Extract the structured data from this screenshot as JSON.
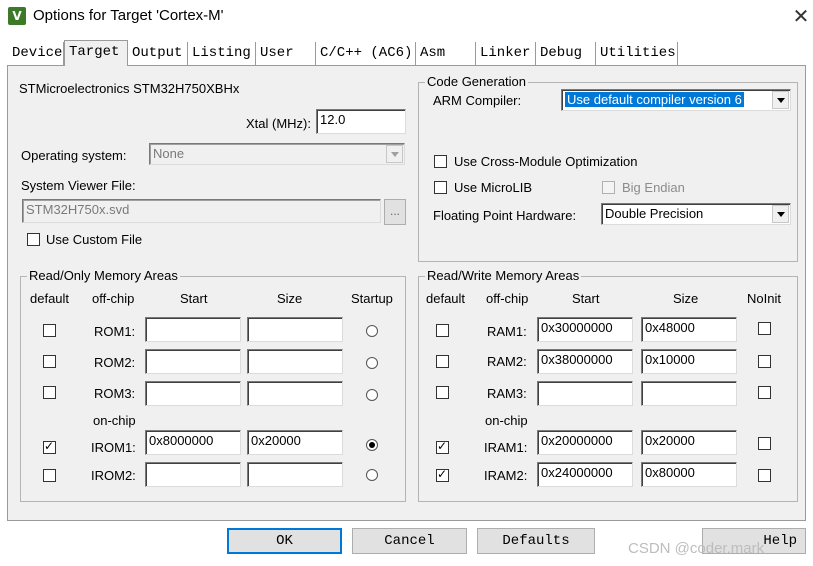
{
  "window": {
    "title": "Options for Target 'Cortex-M'",
    "icon": "keil-uvision-icon"
  },
  "tabs": [
    "Device",
    "Target",
    "Output",
    "Listing",
    "User",
    "C/C++ (AC6)",
    "Asm",
    "Linker",
    "Debug",
    "Utilities"
  ],
  "active_tab": "Target",
  "device": {
    "name": "STMicroelectronics STM32H750XBHx"
  },
  "xtal": {
    "label": "Xtal (MHz):",
    "value": "12.0"
  },
  "os": {
    "label": "Operating system:",
    "value": "None"
  },
  "svf": {
    "label": "System Viewer File:",
    "value": "STM32H750x.svd",
    "browse": "..."
  },
  "custom_file": {
    "label": "Use Custom File",
    "checked": false
  },
  "codegen": {
    "title": "Code Generation",
    "compiler_label": "ARM Compiler:",
    "compiler_value": "Use default compiler version 6",
    "cross_module": "Use Cross-Module Optimization",
    "microlib": "Use MicroLIB",
    "big_endian": "Big Endian",
    "fph_label": "Floating Point Hardware:",
    "fph_value": "Double Precision"
  },
  "ro": {
    "title": "Read/Only Memory Areas",
    "headers": {
      "default": "default",
      "offchip": "off-chip",
      "start": "Start",
      "size": "Size",
      "startup": "Startup"
    },
    "onchip_label": "on-chip",
    "rows": [
      {
        "name": "ROM1:",
        "start": "",
        "size": "",
        "default": false,
        "startup": false
      },
      {
        "name": "ROM2:",
        "start": "",
        "size": "",
        "default": false,
        "startup": false
      },
      {
        "name": "ROM3:",
        "start": "",
        "size": "",
        "default": false,
        "startup": false
      },
      {
        "name": "IROM1:",
        "start": "0x8000000",
        "size": "0x20000",
        "default": true,
        "startup": true
      },
      {
        "name": "IROM2:",
        "start": "",
        "size": "",
        "default": false,
        "startup": false
      }
    ]
  },
  "rw": {
    "title": "Read/Write Memory Areas",
    "headers": {
      "default": "default",
      "offchip": "off-chip",
      "start": "Start",
      "size": "Size",
      "noinit": "NoInit"
    },
    "onchip_label": "on-chip",
    "rows": [
      {
        "name": "RAM1:",
        "start": "0x30000000",
        "size": "0x48000",
        "default": false,
        "noinit": false
      },
      {
        "name": "RAM2:",
        "start": "0x38000000",
        "size": "0x10000",
        "default": false,
        "noinit": false
      },
      {
        "name": "RAM3:",
        "start": "",
        "size": "",
        "default": false,
        "noinit": false
      },
      {
        "name": "IRAM1:",
        "start": "0x20000000",
        "size": "0x20000",
        "default": true,
        "noinit": false
      },
      {
        "name": "IRAM2:",
        "start": "0x24000000",
        "size": "0x80000",
        "default": true,
        "noinit": false
      }
    ]
  },
  "buttons": {
    "ok": "OK",
    "cancel": "Cancel",
    "defaults": "Defaults",
    "help": "Help"
  },
  "watermark": "CSDN @coder.mark"
}
